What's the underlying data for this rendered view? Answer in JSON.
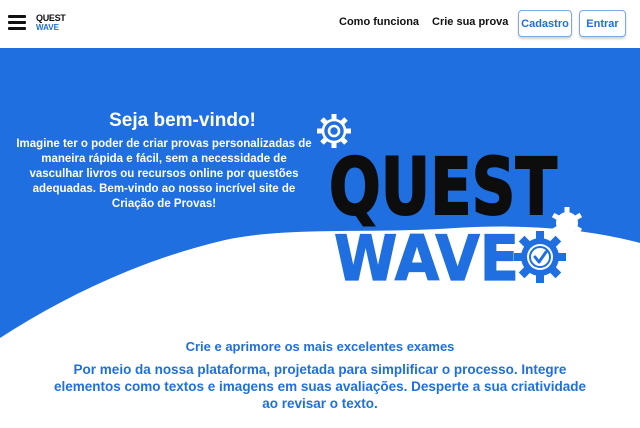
{
  "nav": {
    "logo": {
      "line1": "QUEST",
      "line2": "WAVE"
    },
    "links": [
      "Como funciona",
      "Crie sua prova"
    ],
    "signup_label": "Cadastro",
    "login_label": "Entrar",
    "menu_icon": "hamburger-menu-icon"
  },
  "hero": {
    "title": "Seja bem-vindo!",
    "text": "Imagine ter o poder de criar provas personalizadas de maneira rápida e fácil, sem a necessidade de vasculhar livros ou recursos online por questões adequadas. Bem-vindo ao nosso incrível site de Criação de Provas!",
    "brand": {
      "line1": "QUEST",
      "line2": "WAVE"
    }
  },
  "section": {
    "title": "Crie e aprimore os mais excelentes exames",
    "text": "Por meio da nossa plataforma, projetada para simplificar o processo. Integre elementos como textos e imagens em suas avaliações. Desperte a sua criatividade ao revisar o texto."
  },
  "colors": {
    "primary": "#1f6fe0",
    "dark": "#111111",
    "background": "#ffffff"
  }
}
